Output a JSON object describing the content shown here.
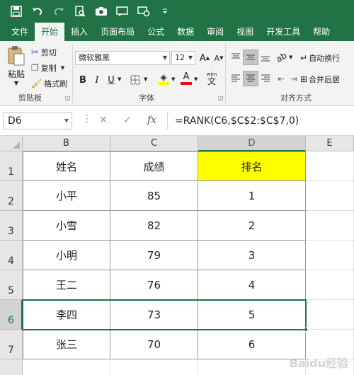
{
  "qat": {
    "icons": [
      "save-icon",
      "undo-icon",
      "redo-icon",
      "print-preview-icon",
      "camera-icon",
      "comment-icon",
      "shape-icon",
      "customize-qat-icon"
    ]
  },
  "tabs": [
    "文件",
    "开始",
    "插入",
    "页面布局",
    "公式",
    "数据",
    "审阅",
    "视图",
    "开发工具",
    "帮助"
  ],
  "active_tab": "开始",
  "ribbon": {
    "clipboard": {
      "paste": "粘贴",
      "cut": "剪切",
      "copy": "复制",
      "format_painter": "格式刷",
      "label": "剪贴板"
    },
    "font": {
      "name": "微软雅黑",
      "size": "12",
      "grow": "A",
      "shrink": "A",
      "bold": "B",
      "italic": "I",
      "underline": "U",
      "label": "字体",
      "pinyin": "wén"
    },
    "alignment": {
      "wrap": "自动换行",
      "merge": "合并后居",
      "label": "对齐方式"
    },
    "colors": {
      "accent": "#217346",
      "highlight": "#ffff00",
      "font_color": "#e81123"
    }
  },
  "formula_bar": {
    "name_box": "D6",
    "formula": "=RANK(C6,$C$2:$C$7,0)",
    "fx": "fx"
  },
  "sheet": {
    "columns": [
      "B",
      "C",
      "D",
      "E"
    ],
    "active_column": "D",
    "rows": [
      "1",
      "2",
      "3",
      "4",
      "5",
      "6",
      "7"
    ],
    "active_row": "6",
    "header": [
      "姓名",
      "成绩",
      "排名"
    ],
    "data": [
      [
        "小平",
        "85",
        "1"
      ],
      [
        "小雪",
        "82",
        "2"
      ],
      [
        "小明",
        "79",
        "3"
      ],
      [
        "王二",
        "76",
        "4"
      ],
      [
        "李四",
        "73",
        "5"
      ],
      [
        "张三",
        "70",
        "6"
      ]
    ]
  },
  "watermark": "Baidu经验"
}
